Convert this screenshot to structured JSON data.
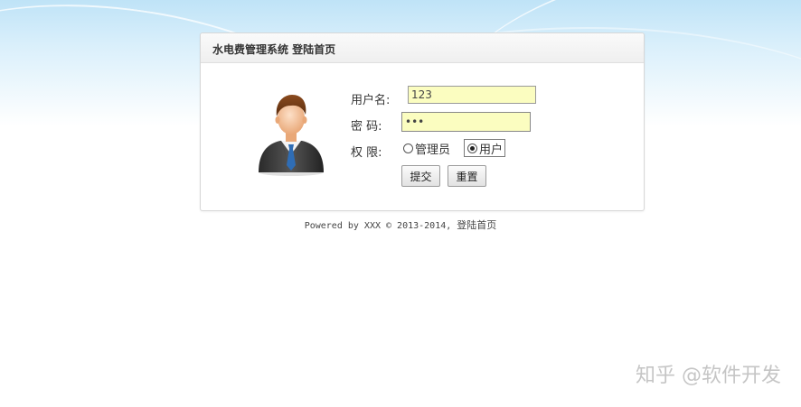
{
  "page": {
    "title": "水电费管理系统 登陆首页"
  },
  "form": {
    "username_label": "用户名:",
    "username_value": "123",
    "password_label": "密 码:",
    "password_value": "123",
    "role_label": "权 限:",
    "role_options": [
      "管理员",
      "用户"
    ],
    "role_selected": "用户",
    "submit_label": "提交",
    "reset_label": "重置"
  },
  "footer": {
    "prefix": "Powered by XXX © 2013-2014,",
    "link": "登陆首页"
  },
  "watermark": "知乎 @软件开发",
  "icons": {
    "avatar": "user-avatar-icon"
  }
}
